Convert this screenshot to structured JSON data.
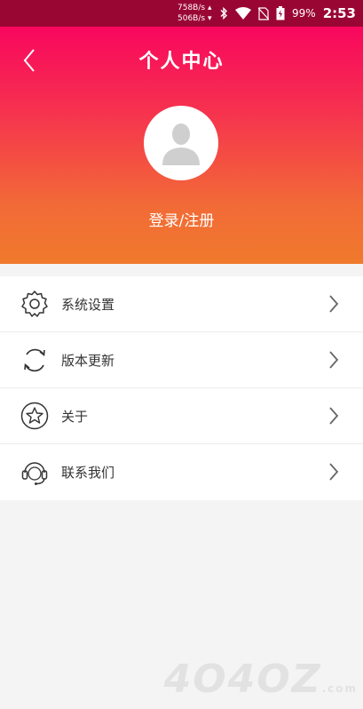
{
  "status_bar": {
    "net_speed_up": "758B/s",
    "net_speed_down": "506B/s",
    "battery": "99%",
    "time": "2:53",
    "icons": [
      "bluetooth-icon",
      "wifi-icon",
      "no-sim-icon",
      "battery-icon"
    ]
  },
  "header": {
    "title": "个人中心",
    "login_label": "登录/注册",
    "icons": [
      "back-arrow-icon",
      "avatar-placeholder-icon"
    ]
  },
  "menu": {
    "items": [
      {
        "label": "系统设置",
        "icon": "gear-icon"
      },
      {
        "label": "版本更新",
        "icon": "refresh-icon"
      },
      {
        "label": "关于",
        "icon": "star-icon"
      },
      {
        "label": "联系我们",
        "icon": "headset-icon"
      }
    ]
  },
  "colors": {
    "gradient_top": "#f8065e",
    "gradient_bottom": "#f07a2c",
    "status_bar": "#9a0634",
    "background": "#f4f4f4"
  }
}
